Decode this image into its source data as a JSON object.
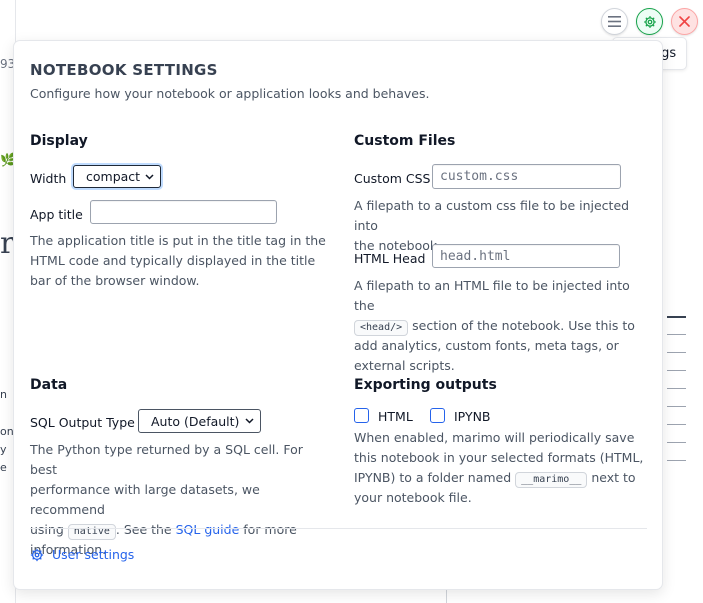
{
  "toolbar": {
    "menu_icon": "hamburger-menu-icon",
    "settings_icon": "gear-icon",
    "close_icon": "close-icon",
    "settings_tooltip": "Settings"
  },
  "background": {
    "fragment_number": "93",
    "fragment_letter": "r",
    "fragment_lines": [
      "n",
      "on",
      "y",
      "e"
    ]
  },
  "panel": {
    "title": "NOTEBOOK SETTINGS",
    "subtitle": "Configure how your notebook or application looks and behaves.",
    "display": {
      "heading": "Display",
      "width_label": "Width",
      "width_value": "compact",
      "app_title_label": "App title",
      "app_title_value": "",
      "description": "The application title is put in the title tag in the HTML code and typically displayed in the title bar of the browser window.",
      "desc_line1": "The application title is put in the title tag in the",
      "desc_line2": "HTML code and typically displayed in the title",
      "desc_line3": "bar of the browser window."
    },
    "custom_files": {
      "heading": "Custom Files",
      "css_label": "Custom CSS",
      "css_placeholder": "custom.css",
      "css_desc_line1": "A filepath to a custom css file to be injected into",
      "css_desc_line2": "the notebook.",
      "head_label": "HTML Head",
      "head_placeholder": "head.html",
      "head_desc_line1": "A filepath to an HTML file to be injected into the",
      "head_code": "<head/>",
      "head_desc_line2_rest": "section of the notebook. Use this to",
      "head_desc_line3": "add analytics, custom fonts, meta tags, or",
      "head_desc_line4": "external scripts."
    },
    "data": {
      "heading": "Data",
      "sql_label": "SQL Output Type",
      "sql_value": "Auto (Default)",
      "desc_line1": "The Python type returned by a SQL cell. For best",
      "desc_line2": "performance with large datasets, we recommend",
      "desc_line3_a": "using",
      "code_native": "native",
      "desc_line3_b": ". See the",
      "sql_guide_link": "SQL guide",
      "desc_line3_c": "for more",
      "desc_line4": "information."
    },
    "exporting": {
      "heading": "Exporting outputs",
      "html_label": "HTML",
      "html_checked": false,
      "ipynb_label": "IPYNB",
      "ipynb_checked": false,
      "desc_line1": "When enabled, marimo will periodically save",
      "desc_line2": "this notebook in your selected formats (HTML,",
      "desc_line3_a": "IPYNB) to a folder named",
      "code_marimo": "__marimo__",
      "desc_line3_b": "next to",
      "desc_line4": "your notebook file."
    },
    "footer": {
      "user_settings_label": "User settings",
      "user_settings_icon": "gear-icon"
    }
  },
  "colors": {
    "accent_blue": "#2563eb",
    "settings_green": "#16a34a",
    "close_red": "#ef4444"
  }
}
